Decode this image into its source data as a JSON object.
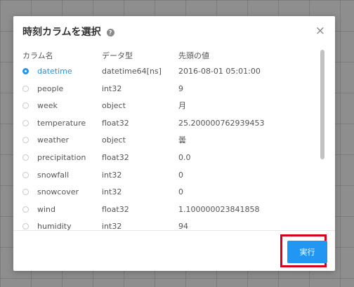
{
  "dialog": {
    "title": "時刻カラムを選択",
    "help_icon": "question-circle-icon",
    "close_label": "×"
  },
  "table": {
    "headers": {
      "name": "カラム名",
      "type": "データ型",
      "value": "先頭の値"
    },
    "rows": [
      {
        "name": "datetime",
        "type": "datetime64[ns]",
        "value": "2016-08-01 05:01:00",
        "selected": true
      },
      {
        "name": "people",
        "type": "int32",
        "value": "9",
        "selected": false
      },
      {
        "name": "week",
        "type": "object",
        "value": "月",
        "selected": false
      },
      {
        "name": "temperature",
        "type": "float32",
        "value": "25.200000762939453",
        "selected": false
      },
      {
        "name": "weather",
        "type": "object",
        "value": "曇",
        "selected": false
      },
      {
        "name": "precipitation",
        "type": "float32",
        "value": "0.0",
        "selected": false
      },
      {
        "name": "snowfall",
        "type": "int32",
        "value": "0",
        "selected": false
      },
      {
        "name": "snowcover",
        "type": "int32",
        "value": "0",
        "selected": false
      },
      {
        "name": "wind",
        "type": "float32",
        "value": "1.100000023841858",
        "selected": false
      },
      {
        "name": "humidity",
        "type": "int32",
        "value": "94",
        "selected": false
      }
    ]
  },
  "footer": {
    "run_label": "実行"
  },
  "colors": {
    "accent": "#2196f3",
    "highlight": "#d9001b"
  }
}
